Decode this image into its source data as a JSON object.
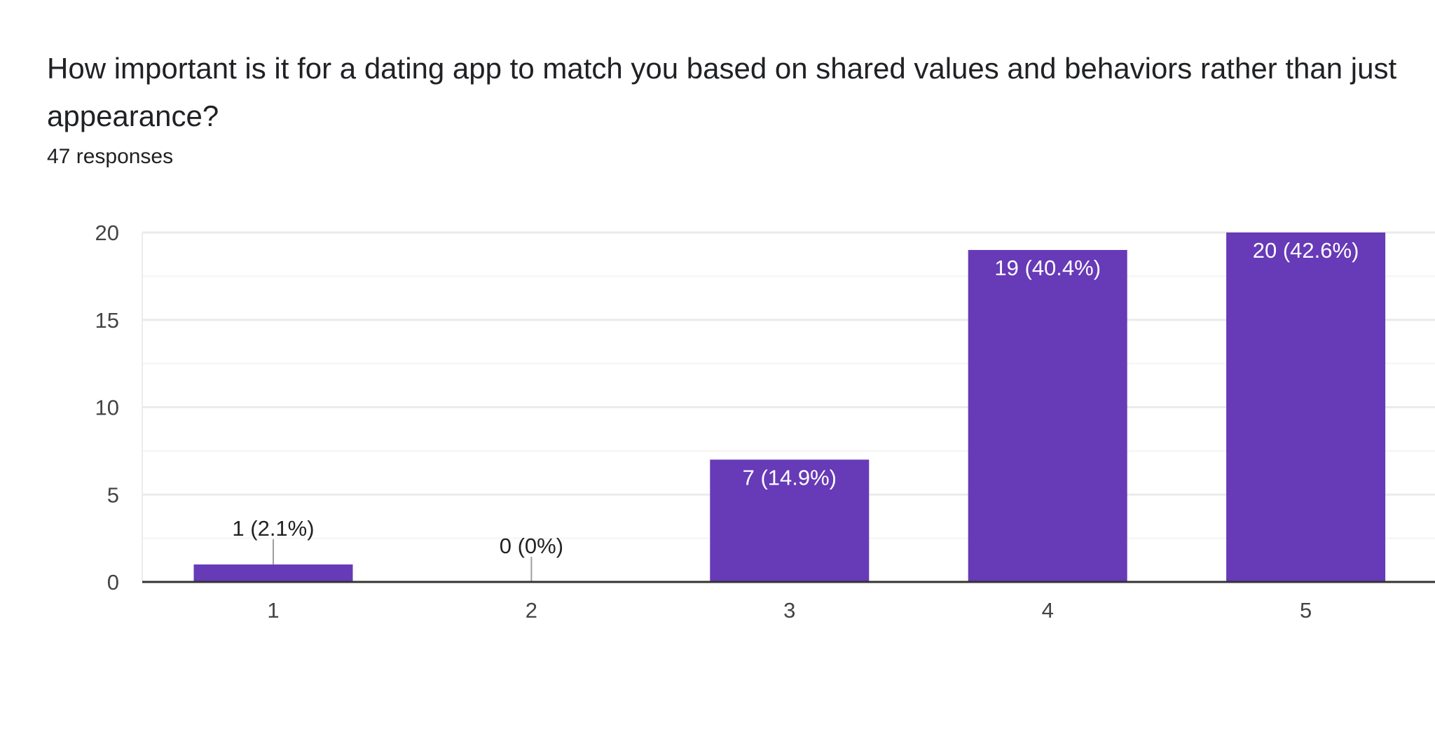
{
  "question": {
    "title": "How important is it for a dating app to match you based on shared values and behaviors rather than just appearance?",
    "responses": "47 responses"
  },
  "chart_data": {
    "type": "bar",
    "categories": [
      "1",
      "2",
      "3",
      "4",
      "5"
    ],
    "values": [
      1,
      0,
      7,
      19,
      20
    ],
    "data_labels": [
      "1 (2.1%)",
      "0 (0%)",
      "7 (14.9%)",
      "19 (40.4%)",
      "20 (42.6%)"
    ],
    "ylim": [
      0,
      20
    ],
    "yticks": [
      0,
      5,
      10,
      15,
      20
    ],
    "grid": true,
    "xlabel": "",
    "ylabel": "",
    "colors": {
      "bar": "#673ab7",
      "grid_major": "#ebebeb",
      "grid_minor": "#f4f4f4",
      "axis": "#333333"
    }
  }
}
